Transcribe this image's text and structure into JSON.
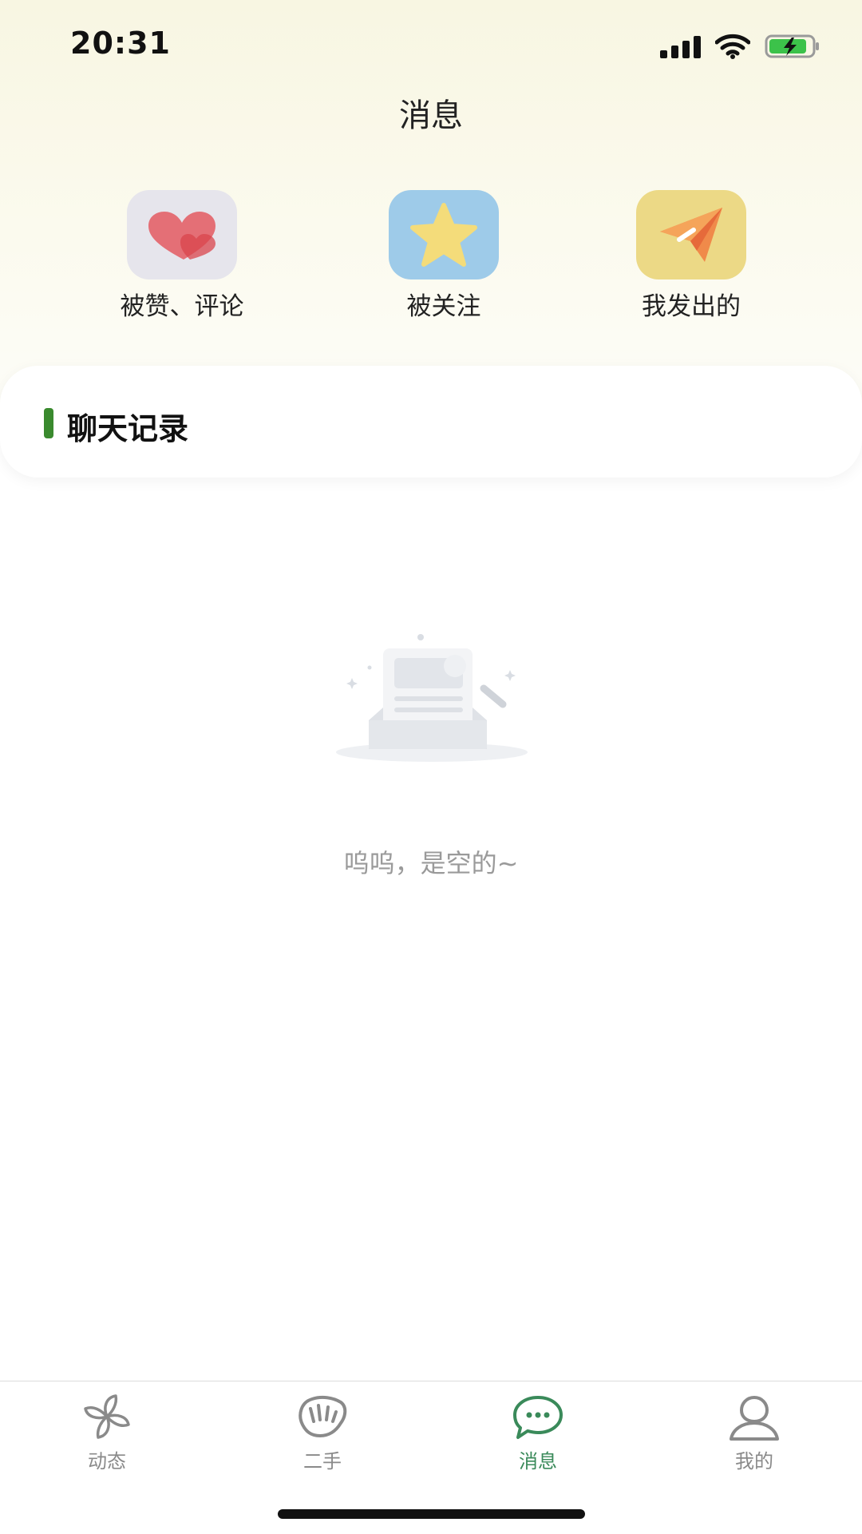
{
  "status_bar": {
    "time": "20:31"
  },
  "header": {
    "title": "消息"
  },
  "shortcuts": [
    {
      "label": "被赞、评论",
      "icon": "hearts-icon",
      "bg": "#e6e5ec"
    },
    {
      "label": "被关注",
      "icon": "star-icon",
      "bg": "#9ecbe9"
    },
    {
      "label": "我发出的",
      "icon": "paper-plane-icon",
      "bg": "#ecd986"
    }
  ],
  "chat_section": {
    "title": "聊天记录",
    "accent_color": "#3a8a2e"
  },
  "empty_state": {
    "text": "呜呜，是空的~",
    "icon": "empty-inbox-illustration"
  },
  "tabs": [
    {
      "label": "动态",
      "icon": "pinwheel-icon",
      "active": false
    },
    {
      "label": "二手",
      "icon": "hand-bag-icon",
      "active": false
    },
    {
      "label": "消息",
      "icon": "chat-bubble-icon",
      "active": true
    },
    {
      "label": "我的",
      "icon": "user-icon",
      "active": false
    }
  ],
  "colors": {
    "active_tab": "#3a8a5a",
    "inactive_tab": "#8a8a8a"
  }
}
